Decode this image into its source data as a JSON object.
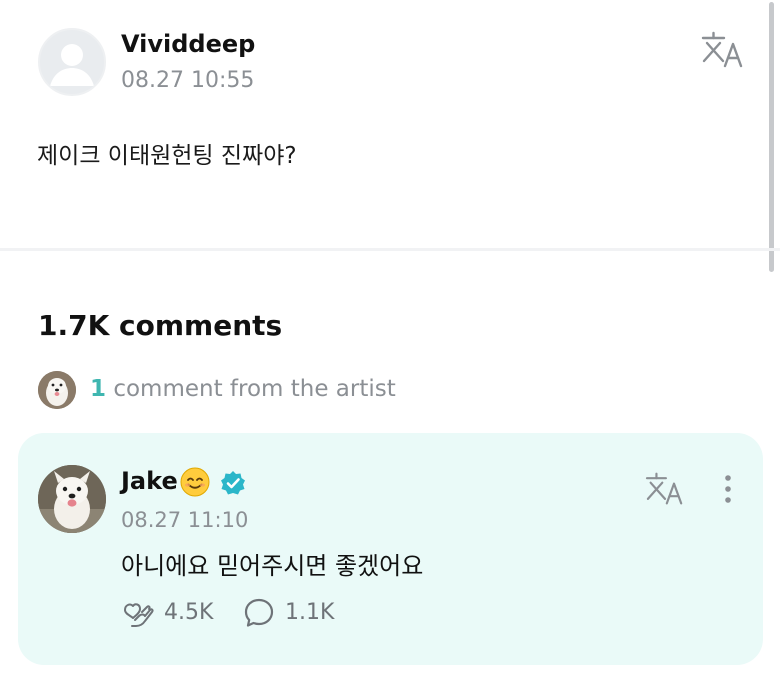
{
  "post": {
    "author": "Vividdeep",
    "time": "08.27 10:55",
    "body": "제이크 이태원헌팅 진짜야?"
  },
  "comments": {
    "count_label": "1.7K comments",
    "artist_count": "1",
    "artist_label": " comment from the artist"
  },
  "comment": {
    "author": "Jake",
    "time": "08.27 11:10",
    "text": "아니에요 믿어주시면 좋겠어요",
    "likes": "4.5K",
    "replies": "1.1K"
  },
  "icons": {
    "translate": "translate-icon",
    "more": "more-vertical-icon",
    "like": "heart-hand-icon",
    "reply": "comment-bubble-icon",
    "verified": "verified-badge-icon",
    "emoji": "smiling-face-emoji"
  },
  "colors": {
    "accent": "#3fb6b0",
    "card_bg": "#eafaf8",
    "muted_text": "#8b8f94",
    "verified_blue": "#2bb6c9"
  }
}
